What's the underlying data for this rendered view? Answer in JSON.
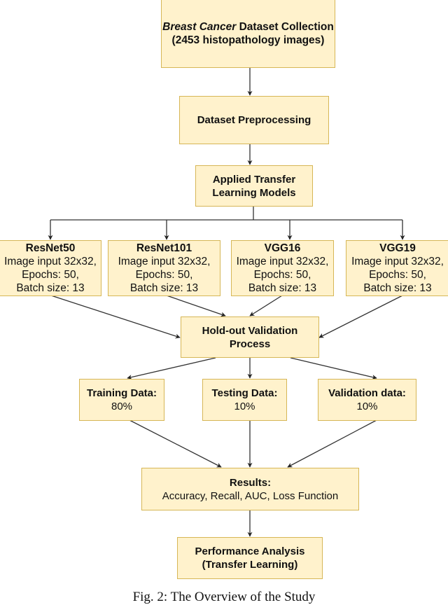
{
  "diagram": {
    "nodes": {
      "collection": {
        "title_italic": "Breast Cancer",
        "title_rest": " Dataset Collection",
        "subtitle": "(2453 histopathology images)"
      },
      "preprocessing": {
        "title": "Dataset Preprocessing"
      },
      "transfer": {
        "line1": "Applied Transfer",
        "line2": "Learning Models"
      },
      "models": [
        {
          "name": "ResNet50",
          "input": "Image input 32x32,",
          "epochs": "Epochs: 50,",
          "batch": "Batch size: 13"
        },
        {
          "name": "ResNet101",
          "input": "Image input 32x32,",
          "epochs": "Epochs: 50,",
          "batch": "Batch size: 13"
        },
        {
          "name": "VGG16",
          "input": "Image input 32x32,",
          "epochs": "Epochs: 50,",
          "batch": "Batch size: 13"
        },
        {
          "name": "VGG19",
          "input": "Image input 32x32,",
          "epochs": "Epochs: 50,",
          "batch": "Batch size: 13"
        }
      ],
      "holdout": {
        "line1": "Hold-out Validation",
        "line2": "Process"
      },
      "splits": [
        {
          "label": "Training Data:",
          "value": "80%"
        },
        {
          "label": "Testing Data:",
          "value": "10%"
        },
        {
          "label": "Validation data:",
          "value": "10%"
        }
      ],
      "results": {
        "title": "Results:",
        "metrics": "Accuracy, Recall, AUC, Loss Function"
      },
      "performance": {
        "line1": "Performance Analysis",
        "line2": "(Transfer Learning)"
      }
    },
    "edges": [
      [
        "collection",
        "preprocessing"
      ],
      [
        "preprocessing",
        "transfer"
      ],
      [
        "transfer",
        "ResNet50"
      ],
      [
        "transfer",
        "ResNet101"
      ],
      [
        "transfer",
        "VGG16"
      ],
      [
        "transfer",
        "VGG19"
      ],
      [
        "ResNet50",
        "holdout"
      ],
      [
        "ResNet101",
        "holdout"
      ],
      [
        "VGG16",
        "holdout"
      ],
      [
        "VGG19",
        "holdout"
      ],
      [
        "holdout",
        "Training Data"
      ],
      [
        "holdout",
        "Testing Data"
      ],
      [
        "holdout",
        "Validation data"
      ],
      [
        "Training Data",
        "results"
      ],
      [
        "Testing Data",
        "results"
      ],
      [
        "Validation data",
        "results"
      ],
      [
        "results",
        "performance"
      ]
    ],
    "colors": {
      "fill": "#fff2cc",
      "stroke": "#d6b656",
      "edge": "#222222"
    }
  },
  "caption": "Fig. 2: The Overview of the Study"
}
